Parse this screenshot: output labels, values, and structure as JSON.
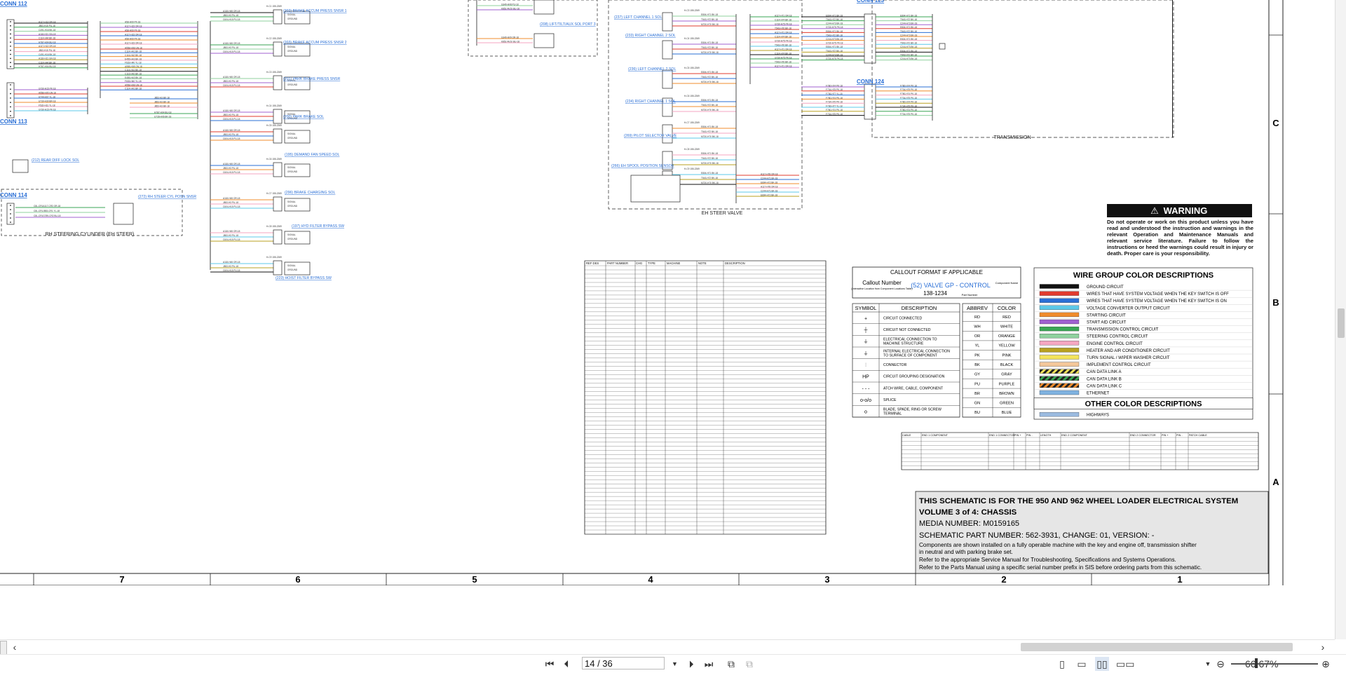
{
  "sheet": {
    "grid_numbers": [
      "7",
      "6",
      "5",
      "4",
      "3",
      "2",
      "1"
    ],
    "grid_letters": [
      "C",
      "B",
      "A"
    ],
    "conn_labels": [
      "CONN 112",
      "CONN 113",
      "CONN 114",
      "CONN 123",
      "CONN 124"
    ],
    "blocks": {
      "rh_steering": "RH STEERING CYLINDER (EH STEER)",
      "transmission": "TRANSMISSION",
      "eh_steer_valve": "EH STEER VALVE"
    },
    "component_links": [
      "(202) BRAKE ACCUM PRESS SNSR 1",
      "(203) BRAKE ACCUM PRESS SNSR 2",
      "(201) PARK BRAKE PRESS SNSR",
      "(200) PARK BRAKE SOL",
      "(195) DEMAND FAN SPEED SOL",
      "(296) BRAKE CHARGING SOL",
      "(197) HYD FILTER BYPASS SW",
      "(223) HOIST FILTER BYPASS SW",
      "(212) REAR DIFF LOCK SOL",
      "(272) RH STEER CYL POSN SNSR",
      "(237) LEFT CHANNEL 1 SOL",
      "(233) RIGHT CHANNEL 2 SOL",
      "(236) LEFT CHANNEL 2 SOL",
      "(234) RIGHT CHANNEL 1 SOL",
      "(269) PILOT SELECTOR VALVE",
      "(266) EH SPOOL POSITION SENSOR",
      "(208) LIFT/TILT/AUX SOL PORT 3"
    ]
  },
  "warning": {
    "title": "WARNING",
    "text": "Do not operate or work on this product unless you have read and understood the instruction and warnings in the relevant Operation and Maintenance Manuals and relevant service literature. Failure to follow the instructions or heed the warnings could result in injury or death. Proper care is your responsibility."
  },
  "callout": {
    "title": "CALLOUT FORMAT IF APPLICABLE",
    "callout_number": "Callout Number",
    "callout_sub": "(Interactive Location from Component Locations Table)",
    "component_name": "(52) VALVE GP - CONTROL",
    "component_name_label": "Component Name",
    "part_number": "138-1234",
    "part_number_label": "Part Number"
  },
  "symbols": {
    "headers": [
      "SYMBOL",
      "DESCRIPTION"
    ],
    "rows": [
      {
        "glyph": "+",
        "desc": "CIRCUIT CONNECTED"
      },
      {
        "glyph": "┼",
        "desc": "CIRCUIT NOT CONNECTED"
      },
      {
        "glyph": "⏚",
        "desc": "ELECTRICAL CONNECTION TO MACHINE STRUCTURE"
      },
      {
        "glyph": "⏚",
        "desc": "INTERNAL ELECTRICAL CONNECTION TO SURFACE OF COMPONENT"
      },
      {
        "glyph": "⫶",
        "desc": "CONNECTOR"
      },
      {
        "glyph": "HP",
        "desc": "CIRCUIT GROUPING DESIGNATION"
      },
      {
        "glyph": "- - -",
        "desc": "ATCH WIRE, CABLE, COMPONENT"
      },
      {
        "glyph": "o-o/o",
        "desc": "SPLICE"
      },
      {
        "glyph": "o",
        "desc": "BLADE, SPADE, RING OR SCREW TERMINAL"
      }
    ]
  },
  "abbrev": {
    "headers": [
      "ABBREV",
      "COLOR"
    ],
    "rows": [
      [
        "RD",
        "RED"
      ],
      [
        "WH",
        "WHITE"
      ],
      [
        "OR",
        "ORANGE"
      ],
      [
        "YL",
        "YELLOW"
      ],
      [
        "PK",
        "PINK"
      ],
      [
        "BK",
        "BLACK"
      ],
      [
        "GY",
        "GRAY"
      ],
      [
        "PU",
        "PURPLE"
      ],
      [
        "BR",
        "BROWN"
      ],
      [
        "GN",
        "GREEN"
      ],
      [
        "BU",
        "BLUE"
      ]
    ]
  },
  "wire_colors": {
    "title": "WIRE GROUP COLOR DESCRIPTIONS",
    "rows": [
      {
        "color": "#111111",
        "label": "GROUND CIRCUIT"
      },
      {
        "color": "#e23b2e",
        "label": "WIRES THAT HAVE SYSTEM VOLTAGE WHEN THE KEY SWITCH IS OFF"
      },
      {
        "color": "#2a6fd6",
        "label": "WIRES THAT HAVE SYSTEM VOLTAGE WHEN THE KEY SWITCH IS ON"
      },
      {
        "color": "#5cc8e8",
        "label": "VOLTAGE CONVERTER OUTPUT CIRCUIT"
      },
      {
        "color": "#f08c2c",
        "label": "STARTING CIRCUIT"
      },
      {
        "color": "#a060d0",
        "label": "START AID CIRCUIT"
      },
      {
        "color": "#3aa655",
        "label": "TRANSMISSION CONTROL CIRCUIT"
      },
      {
        "color": "#8fd19e",
        "label": "STEERING CONTROL CIRCUIT"
      },
      {
        "color": "#f4a6c0",
        "label": "ENGINE CONTROL CIRCUIT"
      },
      {
        "color": "#b8a020",
        "label": "HEATER AND AIR CONDITIONER CIRCUIT"
      },
      {
        "color": "#f3e35a",
        "label": "TURN SIGNAL / WIPER WASHER CIRCUIT"
      },
      {
        "color": "#f4c79a",
        "label": "IMPLEMENT CONTROL CIRCUIT"
      },
      {
        "color": "hatch1",
        "label": "CAN DATA LINK A"
      },
      {
        "color": "hatch2",
        "label": "CAN DATA LINK B"
      },
      {
        "color": "hatch3",
        "label": "CAN DATA LINK C"
      },
      {
        "color": "#7fb2e0",
        "label": "ETHERNET"
      }
    ],
    "other_title": "OTHER COLOR DESCRIPTIONS",
    "other_rows": [
      {
        "color": "#9bbbe0",
        "label": "HIGHWAYS"
      }
    ]
  },
  "title_block": {
    "line1": "THIS SCHEMATIC IS FOR THE 950 AND 962 WHEEL LOADER ELECTRICAL SYSTEM",
    "line2": "VOLUME 3 of 4: CHASSIS",
    "media": "MEDIA NUMBER: M0159165",
    "schematic": "SCHEMATIC PART NUMBER: 562-3931, CHANGE: 01, VERSION: -",
    "note1": "Components are shown installed on a fully operable machine with the key and engine off, transmission shifter",
    "note2": "in neutral and with parking brake set.",
    "note3": "Refer to the appropriate Service Manual for Troubleshooting, Specifications and Systems Operations.",
    "note4": "Refer to the Parts Manual using a specific serial number prefix in SIS before ordering parts from this schematic."
  },
  "harness_table": {
    "headers": [
      "REF DES",
      "PART NUMBER",
      "CHG",
      "TYPE",
      "MACHINE",
      "NOTE",
      "DESCRIPTION"
    ]
  },
  "cable_table": {
    "headers": [
      "CABLE",
      "END 1 COMPONENT",
      "END 1 CONNECTOR",
      "PIN +",
      "PIN -",
      "LENGTH",
      "END 2 COMPONENT",
      "END 2 CONNECTOR",
      "PIN +",
      "PIN -",
      "PATCH CABLE"
    ]
  },
  "viewer": {
    "page_value": "14 / 36",
    "zoom": "66.67%"
  }
}
